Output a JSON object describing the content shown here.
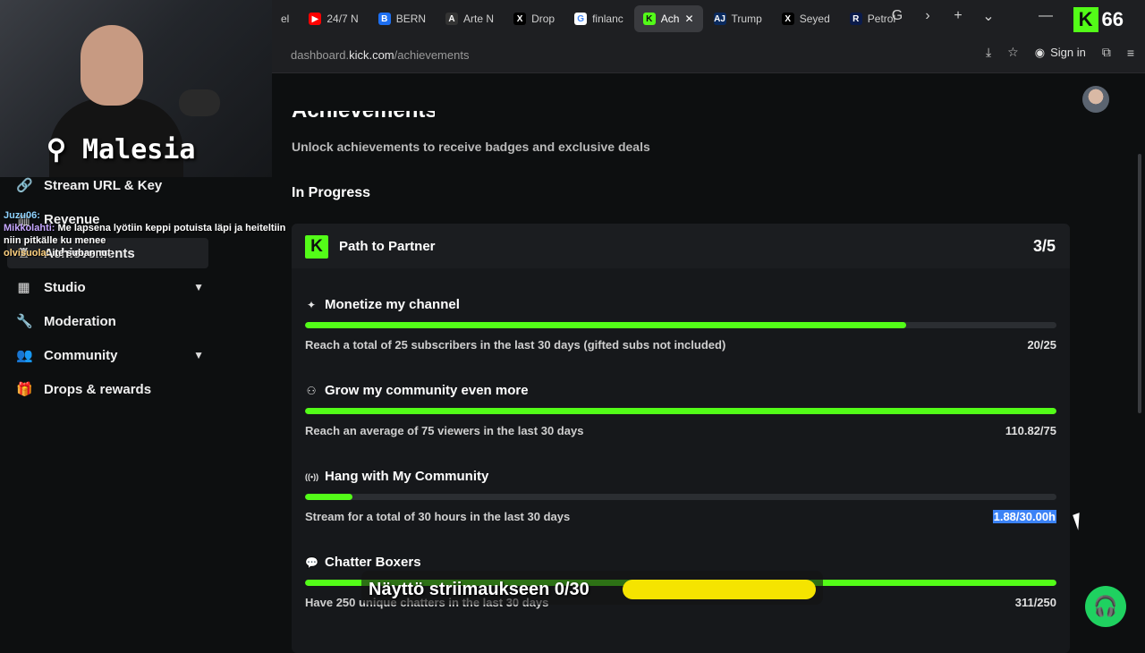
{
  "browser": {
    "tabs": [
      {
        "label": "el",
        "fav": "",
        "color": "#1e1f22"
      },
      {
        "label": "24/7 N",
        "fav": "▶",
        "color": "#ff0000"
      },
      {
        "label": "BERN",
        "fav": "B",
        "color": "#1d6ff2"
      },
      {
        "label": "Arte N",
        "fav": "A",
        "color": "#333"
      },
      {
        "label": "Drop",
        "fav": "X",
        "color": "#000"
      },
      {
        "label": "finlanc",
        "fav": "G",
        "color": "#fff"
      },
      {
        "label": "Ach",
        "fav": "K",
        "color": "#53fc18"
      },
      {
        "label": "Trump",
        "fav": "AJ",
        "color": "#0a2a5e"
      },
      {
        "label": "Seyed",
        "fav": "X",
        "color": "#000"
      },
      {
        "label": "Petrol",
        "fav": "R",
        "color": "#0b1b4a"
      }
    ],
    "url_host": "dashboard.",
    "url_domain": "kick.com",
    "url_path": "/achievements",
    "sign_in": "Sign in"
  },
  "overlay": {
    "logo_count": "66",
    "location": "Malesia",
    "goal_text": "Näyttö striimaukseen 0/30",
    "chat": [
      {
        "user": "Juzu06:",
        "text": ""
      },
      {
        "user": "Mikkolahti:",
        "text": "Me lapsena lyötiin keppi potuista läpi ja heiteltiin niin pitkälle ku menee"
      },
      {
        "user": "olvisuola:",
        "text": "ite subannut"
      }
    ]
  },
  "sidebar": {
    "items": [
      {
        "label": "Stream URL & Key",
        "icon": "link-icon"
      },
      {
        "label": "Revenue",
        "icon": "bank-icon"
      },
      {
        "label": "Achievements",
        "icon": "trophy-icon"
      },
      {
        "label": "Studio",
        "icon": "studio-icon"
      },
      {
        "label": "Moderation",
        "icon": "wrench-icon"
      },
      {
        "label": "Community",
        "icon": "users-icon"
      },
      {
        "label": "Drops & rewards",
        "icon": "gift-icon"
      }
    ]
  },
  "main": {
    "page_title": "Achievements",
    "subtitle": "Unlock achievements to receive badges and exclusive deals",
    "section": "In Progress",
    "card": {
      "title": "Path to Partner",
      "count": "3/5",
      "achievements": [
        {
          "name": "Monetize my channel",
          "icon": "sparkle-icon",
          "desc": "Reach a total of 25 subscribers in the last 30 days (gifted subs not included)",
          "progress": "20/25",
          "fraction": 0.8
        },
        {
          "name": "Grow my community even more",
          "icon": "community-icon",
          "desc": "Reach an average of 75 viewers in the last 30 days",
          "progress": "110.82/75",
          "fraction": 1.0
        },
        {
          "name": "Hang with My Community",
          "icon": "broadcast-icon",
          "desc": "Stream for a total of 30 hours in the last 30 days",
          "progress": "1.88/30.00h",
          "fraction": 0.0627
        },
        {
          "name": "Chatter Boxers",
          "icon": "chat-icon",
          "desc": "Have 250 unique chatters in the last 30 days",
          "progress": "311/250",
          "fraction": 1.0
        }
      ]
    }
  },
  "colors": {
    "accent": "#53fc18",
    "selection": "#3b82f6",
    "goal_bar": "#f5e400"
  }
}
